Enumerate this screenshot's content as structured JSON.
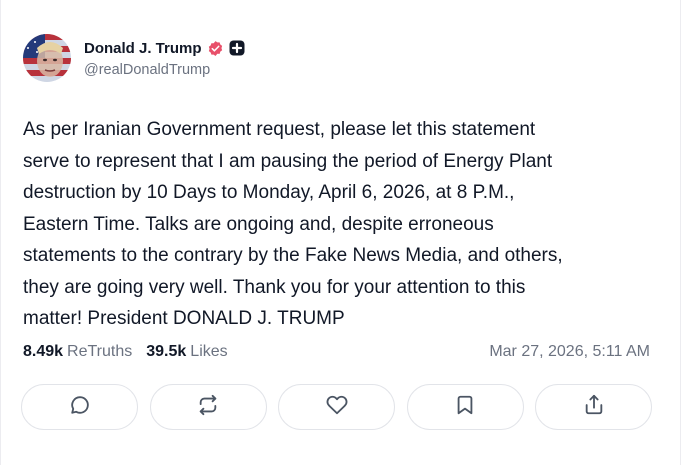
{
  "author": {
    "display_name": "Donald J. Trump",
    "handle": "@realDonaldTrump",
    "verified_icon": "verified-badge-icon",
    "extra_icon": "plus-square-icon"
  },
  "post": {
    "text": "As per Iranian Government request, please let this statement\nserve to represent that I am pausing the period of Energy Plant\ndestruction by 10 Days to Monday, April 6, 2026, at 8 P.M.,\nEastern Time. Talks are ongoing and, despite erroneous\nstatements to the contrary by the Fake News Media, and others,\nthey are going very well. Thank you for your attention to this\nmatter! President DONALD J. TRUMP"
  },
  "stats": {
    "retruths_count": "8.49k",
    "retruths_label": "ReTruths",
    "likes_count": "39.5k",
    "likes_label": "Likes",
    "timestamp": "Mar 27, 2026, 5:11 AM"
  },
  "actions": [
    {
      "name": "reply",
      "icon": "comment-icon"
    },
    {
      "name": "retruth",
      "icon": "repost-icon"
    },
    {
      "name": "like",
      "icon": "heart-icon"
    },
    {
      "name": "bookmark",
      "icon": "bookmark-icon"
    },
    {
      "name": "share",
      "icon": "share-icon"
    }
  ],
  "colors": {
    "verified": "#e8506a",
    "muted_text": "#6b7280",
    "border": "#e2e4e9"
  }
}
